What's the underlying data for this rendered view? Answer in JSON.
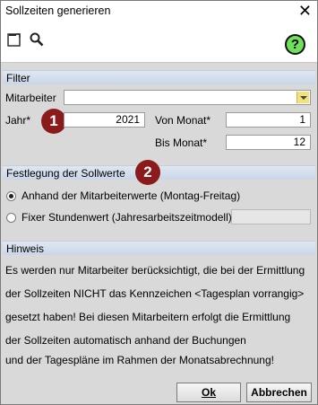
{
  "window": {
    "title": "Sollzeiten generieren"
  },
  "icons": {
    "new": "new-document-icon",
    "search": "search-icon",
    "help": "help-icon"
  },
  "help_label": "?",
  "filter": {
    "section_title": "Filter",
    "mitarbeiter_label": "Mitarbeiter",
    "mitarbeiter_value": "",
    "jahr_label": "Jahr*",
    "jahr_value": "2021",
    "von_monat_label": "Von Monat*",
    "von_monat_value": "1",
    "bis_monat_label": "Bis Monat*",
    "bis_monat_value": "12",
    "badge": "1"
  },
  "sollwerte": {
    "section_title": "Festlegung der Sollwerte",
    "badge": "2",
    "option1": "Anhand der Mitarbeiterwerte (Montag-Freitag)",
    "option2": "Fixer Stundenwert (Jahresarbeitszeitmodell)*",
    "selected": "option1",
    "stunden_value": ""
  },
  "hinweis": {
    "section_title": "Hinweis",
    "lines": [
      "Es werden nur Mitarbeiter berücksichtigt, die bei der Ermittlung",
      "der Sollzeiten NICHT das Kennzeichen <Tagesplan vorrangig>",
      "gesetzt haben! Bei diesen Mitarbeitern erfolgt die Ermittlung",
      "der Sollzeiten automatisch anhand der Buchungen",
      "und der Tagespläne im Rahmen der Monatsabrechnung!"
    ]
  },
  "buttons": {
    "ok": "Ok",
    "cancel": "Abbrechen"
  },
  "colors": {
    "badge": "#8b1b1b",
    "help": "#6ee05a",
    "dropdown": "#f3e27a"
  }
}
